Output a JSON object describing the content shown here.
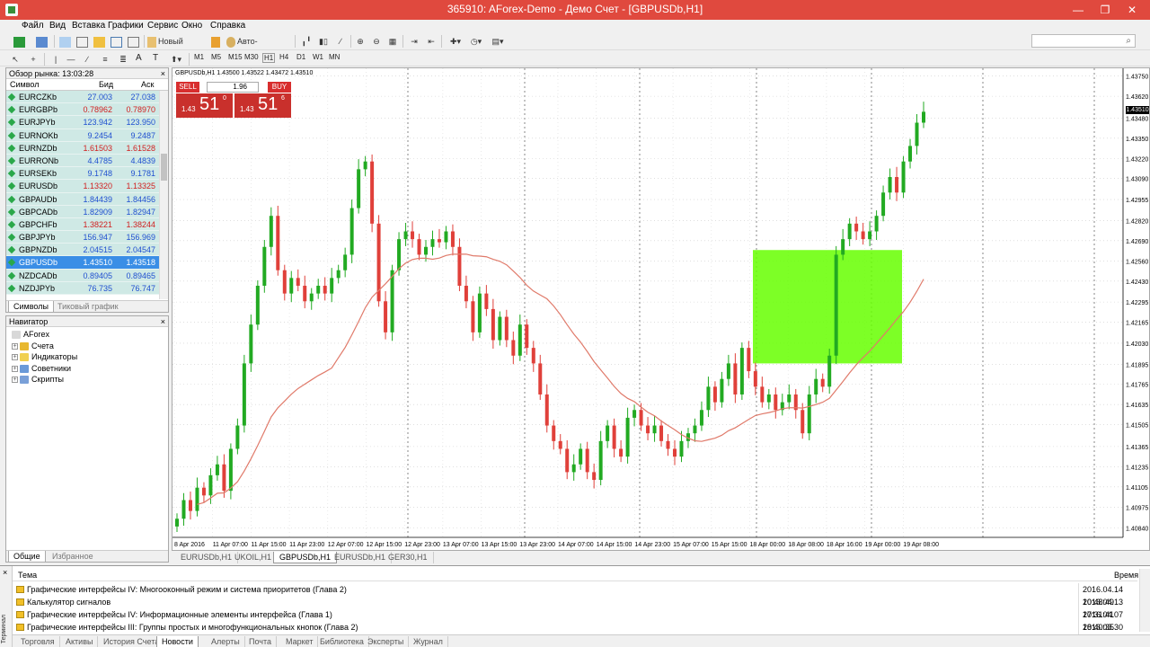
{
  "window": {
    "title": "365910: AForex-Demo - Демо Счет - [GBPUSDb,H1]",
    "controls": [
      "—",
      "❐",
      "✕"
    ]
  },
  "menu": [
    "Файл",
    "Вид",
    "Вставка",
    "Графики",
    "Сервис",
    "Окно",
    "Справка"
  ],
  "toolbar": {
    "new_order": "Новый ордер",
    "auto_trading": "Авто-торговля",
    "timeframes": [
      "M1",
      "M5",
      "M15",
      "M30",
      "H1",
      "H4",
      "D1",
      "W1",
      "MN"
    ],
    "text_tool": "A",
    "label_tool": "T"
  },
  "market_watch": {
    "header": "Обзор рынка: 13:03:28",
    "col_symbol": "Символ",
    "col_bid": "Бид",
    "col_ask": "Аск",
    "rows": [
      {
        "symbol": "EURCZKb",
        "bid": "27.003",
        "ask": "27.038"
      },
      {
        "symbol": "EURGBPb",
        "bid": "0.78962",
        "ask": "0.78970"
      },
      {
        "symbol": "EURJPYb",
        "bid": "123.942",
        "ask": "123.950"
      },
      {
        "symbol": "EURNOKb",
        "bid": "9.2454",
        "ask": "9.2487"
      },
      {
        "symbol": "EURNZDb",
        "bid": "1.61503",
        "ask": "1.61528"
      },
      {
        "symbol": "EURRONb",
        "bid": "4.4785",
        "ask": "4.4839"
      },
      {
        "symbol": "EURSEKb",
        "bid": "9.1748",
        "ask": "9.1781"
      },
      {
        "symbol": "EURUSDb",
        "bid": "1.13320",
        "ask": "1.13325"
      },
      {
        "symbol": "GBPAUDb",
        "bid": "1.84439",
        "ask": "1.84456"
      },
      {
        "symbol": "GBPCADb",
        "bid": "1.82909",
        "ask": "1.82947"
      },
      {
        "symbol": "GBPCHFb",
        "bid": "1.38221",
        "ask": "1.38244"
      },
      {
        "symbol": "GBPJPYb",
        "bid": "156.947",
        "ask": "156.969"
      },
      {
        "symbol": "GBPNZDb",
        "bid": "2.04515",
        "ask": "2.04547"
      },
      {
        "symbol": "GBPUSDb",
        "bid": "1.43510",
        "ask": "1.43518"
      },
      {
        "symbol": "NZDCADb",
        "bid": "0.89405",
        "ask": "0.89465"
      },
      {
        "symbol": "NZDJPYb",
        "bid": "76.735",
        "ask": "76.747"
      }
    ],
    "tabs": [
      "Символы",
      "Тиковый график"
    ]
  },
  "navigator": {
    "header": "Навигатор",
    "root": "AForex",
    "items": [
      "Счета",
      "Индикаторы",
      "Советники",
      "Скрипты"
    ],
    "tabs": [
      "Общие",
      "Избранное"
    ]
  },
  "chart": {
    "info": "GBPUSDb,H1  1.43500 1.43522 1.43472 1.43510",
    "sell_label": "SELL",
    "buy_label": "BUY",
    "lot": "1.96",
    "sell_prefix": "1.43",
    "sell_big": "51",
    "sell_sup": "0",
    "buy_prefix": "1.43",
    "buy_big": "51",
    "buy_sup": "6",
    "current_price": "1.43510",
    "price_labels": [
      "1.43750",
      "1.43620",
      "1.43480",
      "1.43350",
      "1.43220",
      "1.43090",
      "1.42955",
      "1.42820",
      "1.42690",
      "1.42560",
      "1.42430",
      "1.42295",
      "1.42165",
      "1.42030",
      "1.41895",
      "1.41765",
      "1.41635",
      "1.41505",
      "1.41365",
      "1.41235",
      "1.41105",
      "1.40975",
      "1.40840"
    ],
    "time_labels": [
      "8 Apr 2016",
      "11 Apr 07:00",
      "11 Apr 15:00",
      "11 Apr 23:00",
      "12 Apr 07:00",
      "12 Apr 15:00",
      "12 Apr 23:00",
      "13 Apr 07:00",
      "13 Apr 15:00",
      "13 Apr 23:00",
      "14 Apr 07:00",
      "14 Apr 15:00",
      "14 Apr 23:00",
      "15 Apr 07:00",
      "15 Apr 15:00",
      "18 Apr 00:00",
      "18 Apr 08:00",
      "18 Apr 16:00",
      "19 Apr 00:00",
      "19 Apr 08:00"
    ],
    "colors": {
      "bull": "#22aa22",
      "bear": "#e0403a",
      "ma": "#e07a6a",
      "box": "#66ff00"
    }
  },
  "chart_tabs": [
    "EURUSDb,H1",
    "UKOIL,H1",
    "GBPUSDb,H1",
    "EURUSDb,H1",
    "GER30,H1"
  ],
  "terminal": {
    "side_label": "Терминал",
    "col_subject": "Тема",
    "col_time": "Время",
    "news": [
      {
        "subject": "Графические интерфейсы IV: Многооконный режим и система приоритетов (Глава 2)",
        "time": "2016.04.14 10:48:49"
      },
      {
        "subject": "Калькулятор сигналов",
        "time": "2016.04.13 17:31:41"
      },
      {
        "subject": "Графические интерфейсы IV: Информационные элементы интерфейса (Глава 1)",
        "time": "2016.04.07 18:40:35"
      },
      {
        "subject": "Графические интерфейсы III: Группы простых и многофункциональных кнопок (Глава 2)",
        "time": "2016.03.30 13:55:52"
      }
    ],
    "tabs": [
      "Торговля",
      "Активы",
      "История Счета",
      "Новости",
      "Алерты",
      "Почта",
      "Маркет",
      "Библиотека",
      "Эксперты",
      "Журнал"
    ]
  }
}
